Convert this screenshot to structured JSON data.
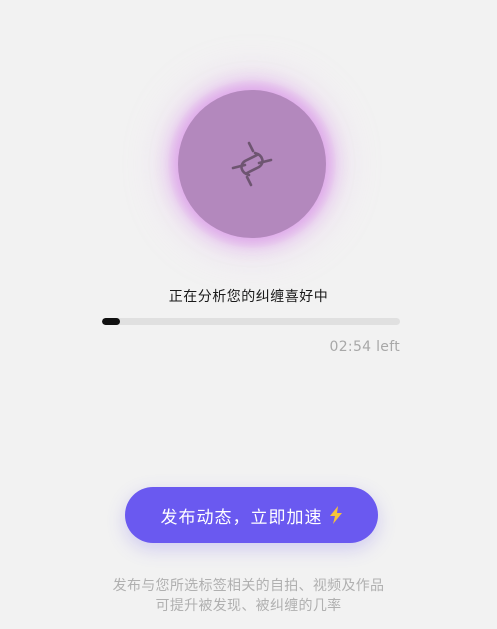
{
  "analysis": {
    "icon": "link-break-icon",
    "status_text": "正在分析您的纠缠喜好中",
    "progress_fraction": 0.06,
    "time_left": "02:54 left"
  },
  "cta": {
    "label": "发布动态，立即加速",
    "icon": "lightning-bolt-icon"
  },
  "footer": {
    "line1": "发布与您所选标签相关的自拍、视频及作品",
    "line2": "可提升被发现、被纠缠的几率"
  },
  "colors": {
    "orb": "#b388bd",
    "orb_glow": "#d68ce6",
    "button": "#6a59f0",
    "bolt": "#f5c33b",
    "progress_fill": "#111111",
    "progress_track": "#e0e0e0"
  }
}
